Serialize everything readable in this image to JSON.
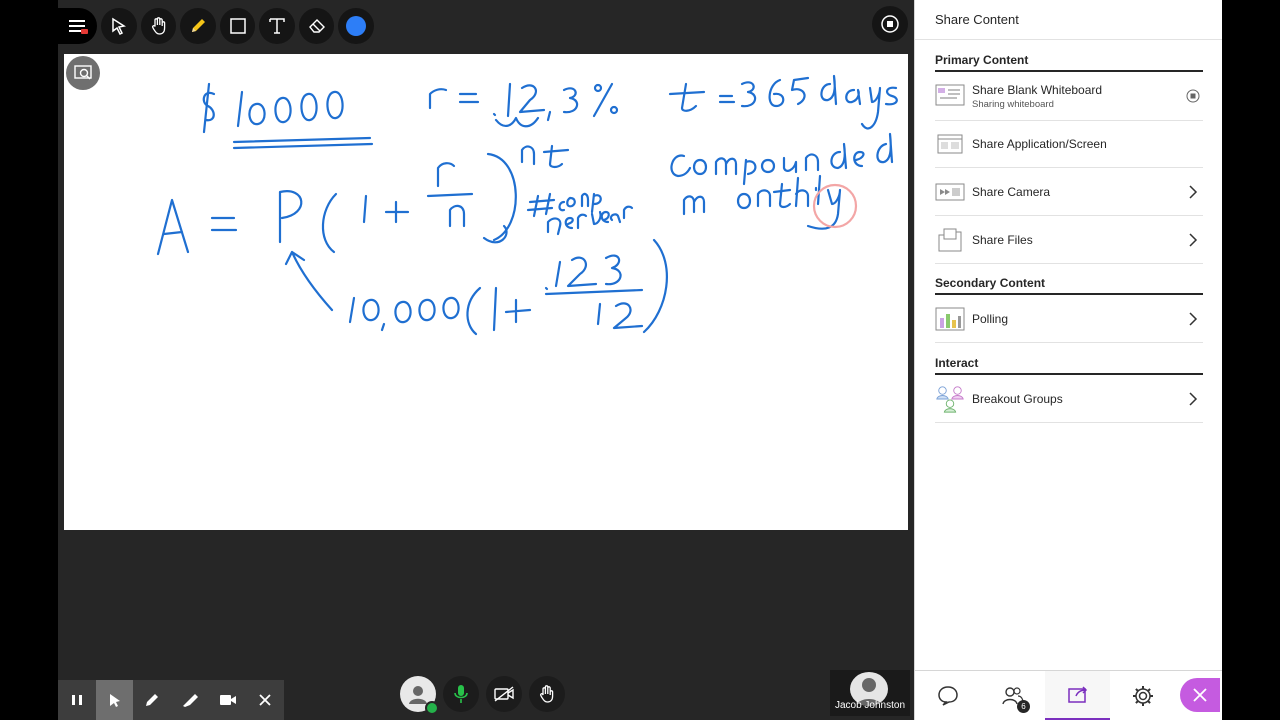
{
  "toolbar": {
    "tools": [
      "menu-icon",
      "select-icon",
      "pan-hand-icon",
      "pencil-icon",
      "rectangle-icon",
      "text-icon",
      "eraser-icon",
      "color-picker-icon"
    ],
    "active_color": "#2d7ef7"
  },
  "whiteboard": {
    "ink_color": "#1f6fd1",
    "handwriting": {
      "principal": "$10,000",
      "rate": "r = .12,3%",
      "time": "t = 365 days",
      "formula": "A = P(1 + r/n)^nt",
      "exponent": "nt",
      "note_n": "# comp per year",
      "note_comp": "Compounded monthly",
      "substitution": "10,000(1 + .123/12)"
    }
  },
  "bottom_left": {
    "tools": [
      "pause-icon",
      "pointer-icon",
      "pen-icon",
      "highlighter-icon",
      "video-icon",
      "close-icon"
    ]
  },
  "bottom_center": {
    "controls": [
      "avatar",
      "microphone-icon",
      "camera-off-icon",
      "raise-hand-icon"
    ]
  },
  "participant_tile": {
    "name": "Jacob Johnston"
  },
  "panel": {
    "title": "Share Content",
    "sections": {
      "primary": "Primary Content",
      "secondary": "Secondary Content",
      "interact": "Interact"
    },
    "items": {
      "whiteboard": {
        "label": "Share Blank Whiteboard",
        "sub": "Sharing whiteboard"
      },
      "screen": {
        "label": "Share Application/Screen"
      },
      "camera": {
        "label": "Share Camera"
      },
      "files": {
        "label": "Share Files"
      },
      "polling": {
        "label": "Polling"
      },
      "breakout": {
        "label": "Breakout Groups"
      }
    },
    "tabs": {
      "chat": "chat-icon",
      "attendees": "attendees-icon",
      "attendee_count": "6",
      "share": "share-content-icon",
      "settings": "gear-icon"
    },
    "accent": "#7b2fbe",
    "close_color": "#c55be0"
  }
}
